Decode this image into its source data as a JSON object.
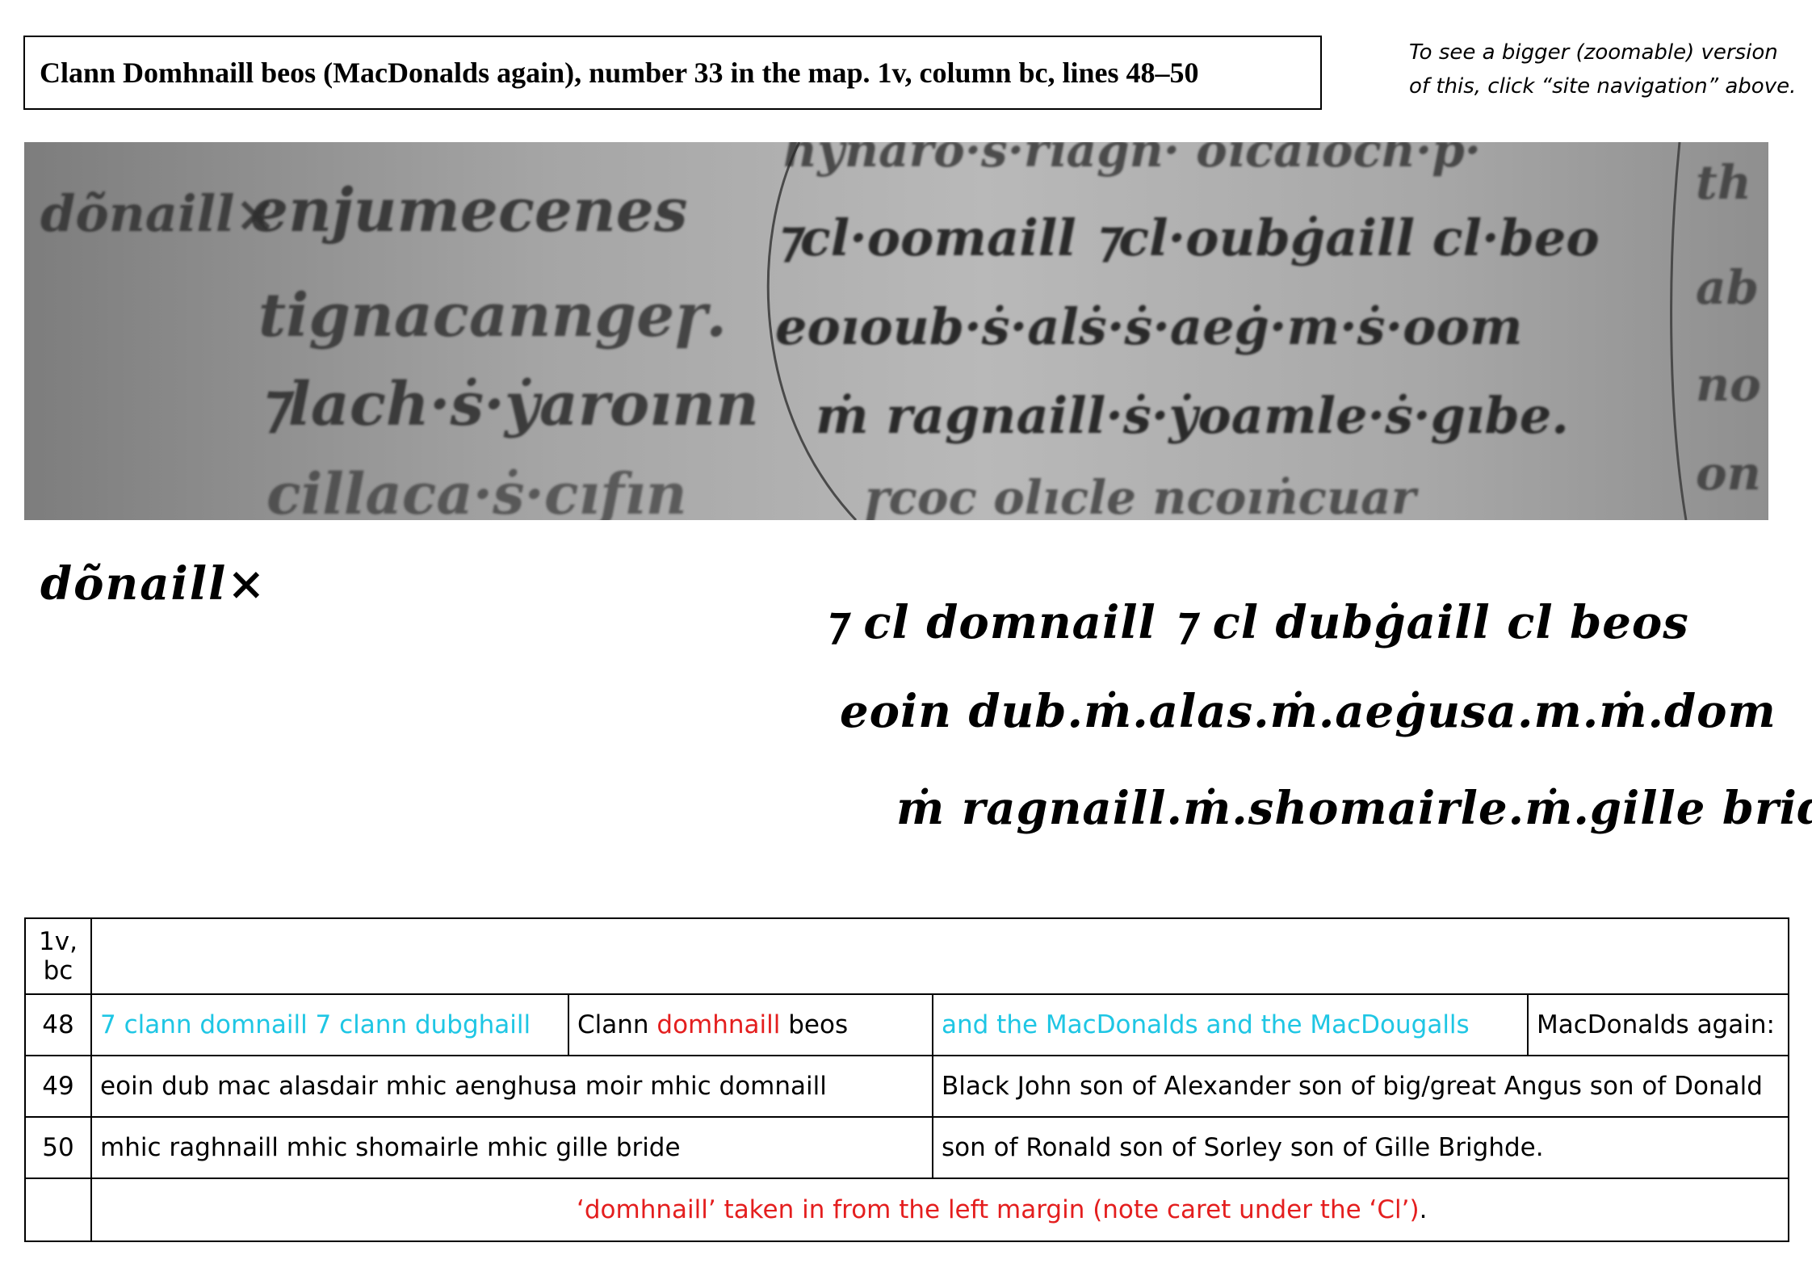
{
  "title": "Clann Domhnaill beos (MacDonalds again), number 33 in the map. 1v, column bc, lines 48–50",
  "nav_note": {
    "line1": "To see a bigger (zoomable) version",
    "line2": "of this, click “site navigation” above."
  },
  "manuscript_image": {
    "icon": "manuscript-photo"
  },
  "transcription": {
    "margin": "dõnaill×",
    "lines": [
      "⁊ cl domnaill ⁊ cl dubġaill cl beos",
      "eoin dub.ṁ.alas.ṁ.aeġusa.m.ṁ.dom",
      "ṁ ragnaill.ṁ.shomairle.ṁ.gille bride."
    ]
  },
  "table": {
    "header_label_line1": "1v,",
    "header_label_line2": "bc",
    "rows": [
      {
        "num": "48",
        "gaelic_a": "7 clann domnaill 7 clann dubghaill",
        "gaelic_b_pre": "Clann ",
        "gaelic_b_red": "domhnaill",
        "gaelic_b_post": " beos",
        "english_a": "and the MacDonalds and the MacDougalls",
        "english_b": "MacDonalds again:"
      },
      {
        "num": "49",
        "gaelic": "eoin dub mac alasdair mhic aenghusa moir mhic domnaill",
        "english": "Black John son of Alexander son of big/great Angus son of Donald"
      },
      {
        "num": "50",
        "gaelic": "mhic raghnaill mhic shomairle mhic gille bride",
        "english": "son of Ronald son of Sorley son of Gille Brighde."
      }
    ],
    "note_red": "‘domhnaill’ taken in from the left margin (note caret under the ‘Cl’)",
    "note_end": "."
  },
  "colors": {
    "cyan": "#1ec6e4",
    "red": "#e41e1e"
  }
}
